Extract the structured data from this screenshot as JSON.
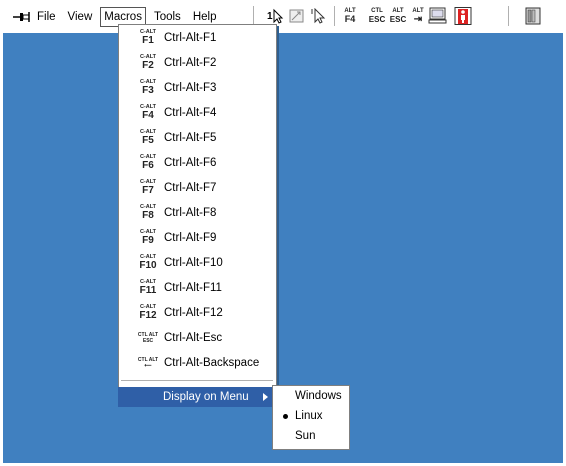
{
  "toolbar": {
    "menus": [
      "File",
      "View",
      "Macros",
      "Tools",
      "Help"
    ],
    "icons": {
      "alt_f4": {
        "top": "ALT",
        "bot": "F4"
      },
      "ctl_esc": {
        "top": "CTL",
        "bot": "ESC"
      },
      "alt_esc": {
        "top": "ALT",
        "bot": "ESC"
      },
      "alt_tab": {
        "top": "ALT",
        "bot": "⇥"
      }
    }
  },
  "macros_menu": {
    "items": [
      {
        "key_top": "C-ALT",
        "key": "F1",
        "label": "Ctrl-Alt-F1"
      },
      {
        "key_top": "C-ALT",
        "key": "F2",
        "label": "Ctrl-Alt-F2"
      },
      {
        "key_top": "C-ALT",
        "key": "F3",
        "label": "Ctrl-Alt-F3"
      },
      {
        "key_top": "C-ALT",
        "key": "F4",
        "label": "Ctrl-Alt-F4"
      },
      {
        "key_top": "C-ALT",
        "key": "F5",
        "label": "Ctrl-Alt-F5"
      },
      {
        "key_top": "C-ALT",
        "key": "F6",
        "label": "Ctrl-Alt-F6"
      },
      {
        "key_top": "C-ALT",
        "key": "F7",
        "label": "Ctrl-Alt-F7"
      },
      {
        "key_top": "C-ALT",
        "key": "F8",
        "label": "Ctrl-Alt-F8"
      },
      {
        "key_top": "C-ALT",
        "key": "F9",
        "label": "Ctrl-Alt-F9"
      },
      {
        "key_top": "C-ALT",
        "key": "F10",
        "label": "Ctrl-Alt-F10"
      },
      {
        "key_top": "C-ALT",
        "key": "F11",
        "label": "Ctrl-Alt-F11"
      },
      {
        "key_top": "C-ALT",
        "key": "F12",
        "label": "Ctrl-Alt-F12"
      },
      {
        "key_top": "CTL ALT",
        "key": "ESC",
        "label": "Ctrl-Alt-Esc"
      },
      {
        "key_top": "CTL ALT",
        "key": "⟵",
        "label": "Ctrl-Alt-Backspace"
      }
    ],
    "display_on_menu": "Display on Menu"
  },
  "submenu": {
    "items": [
      "Windows",
      "Linux",
      "Sun"
    ],
    "selected": "Linux"
  },
  "colors": {
    "desktop": "#4080c0",
    "highlight": "#2f5fa7"
  }
}
